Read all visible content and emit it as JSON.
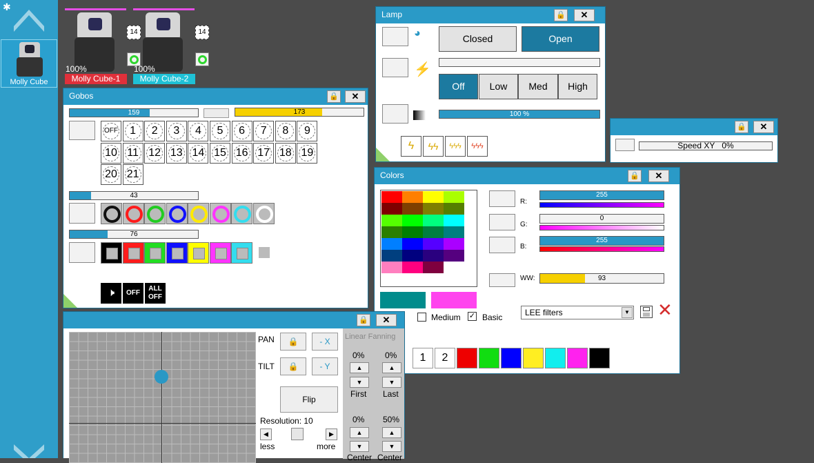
{
  "dock": {
    "fixture_name": "Molly Cube"
  },
  "fixtures": [
    {
      "intensity": "100%",
      "name": "Molly Cube-1",
      "color": "#e0303a",
      "channel": "14"
    },
    {
      "intensity": "100%",
      "name": "Molly Cube-2",
      "color": "#1fc1d6",
      "channel": "14"
    }
  ],
  "gobos": {
    "title": "Gobos",
    "bar1": 159,
    "bar2": 173,
    "bar3": 43,
    "bar4": 76,
    "wheel_labels": [
      "OFF",
      "1",
      "2",
      "3",
      "4",
      "5",
      "6",
      "7",
      "8",
      "9",
      "10",
      "11",
      "12",
      "13",
      "14",
      "15",
      "16",
      "17",
      "18",
      "19",
      "20",
      "21"
    ],
    "ring_colors": [
      "#111111",
      "#ff1c1c",
      "#22cc22",
      "#1010ff",
      "#ffea00",
      "#ff33ff",
      "#33ddee",
      "#ffffff"
    ],
    "frame_colors": [
      "#000000",
      "#ff1c1c",
      "#22dd22",
      "#1010ff",
      "#ffff00",
      "#ff33ff",
      "#33ddee"
    ],
    "off_label": "OFF",
    "all_off_label": "ALL OFF"
  },
  "lamp": {
    "title": "Lamp",
    "closed_label": "Closed",
    "open_label": "Open",
    "modes": [
      "Off",
      "Low",
      "Med",
      "High"
    ],
    "intensity_label": "100 %",
    "intensity_value": 100
  },
  "speed": {
    "label": "Speed XY",
    "value": "0%"
  },
  "colors": {
    "title": "Colors",
    "palette": [
      [
        "#ff0000",
        "#ff7f00",
        "#ffff00",
        "#aaff00"
      ],
      [
        "#7f0000",
        "#7f3f00",
        "#7f7f00",
        "#557f00"
      ],
      [
        "#55ff00",
        "#00ff00",
        "#00ff7f",
        "#00ffff"
      ],
      [
        "#2a7f00",
        "#007f00",
        "#007f3f",
        "#007f7f"
      ],
      [
        "#007fff",
        "#0000ff",
        "#5500ff",
        "#aa00ff"
      ],
      [
        "#003f7f",
        "#00007f",
        "#2a007f",
        "#55007f"
      ],
      [
        "#ff7fbf",
        "#ff007f",
        "#7f003f",
        "#ffffff"
      ]
    ],
    "preview_left": "#008c8c",
    "preview_right": "#ff44ee",
    "r_label": "R:",
    "r_value": "255",
    "r_num": 255,
    "g_label": "G:",
    "g_value": "0",
    "g_num": 0,
    "b_label": "B:",
    "b_value": "255",
    "b_num": 255,
    "ww_label": "WW:",
    "ww_value": "93",
    "ww_num": 93,
    "medium_label": "Medium",
    "basic_label": "Basic",
    "filter_value": "LEE filters",
    "presets": [
      "1",
      "2"
    ],
    "preset_colors": [
      "#ee0000",
      "#11dd11",
      "#0000ff",
      "#ffee22",
      "#11eeee",
      "#ff22ee",
      "#000000"
    ]
  },
  "pantilt": {
    "pan_label": "PAN",
    "tilt_label": "TILT",
    "neg_x": "- X",
    "neg_y": "- Y",
    "flip_label": "Flip",
    "resolution_label": "Resolution: 10",
    "less_label": "less",
    "more_label": "more",
    "fanning_title": "Linear Fanning",
    "first_value": "0%",
    "last_value": "0%",
    "first_label": "First",
    "last_label": "Last",
    "center1_value": "0%",
    "center2_value": "50%",
    "center1_label": "Center",
    "center2_label": "Center"
  }
}
